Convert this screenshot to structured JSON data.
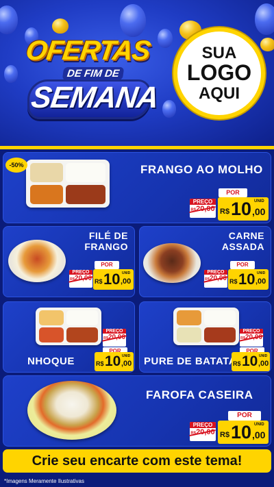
{
  "header": {
    "title_top": "OFERTAS",
    "title_mid": "DE FIM DE",
    "title_bottom": "SEMANA",
    "logo_lines": [
      "SUA",
      "LOGO",
      "AQUI"
    ]
  },
  "discount_badge": "-50%",
  "products": [
    {
      "name": "FRANGO AO MOLHO",
      "preco_label": "PREÇO",
      "old_currency": "R$",
      "old_price": "20,00",
      "por_label": "POR",
      "new_currency": "R$",
      "new_int": "10",
      "new_dec": ",00",
      "unit": "UNID"
    },
    {
      "name_lines": [
        "FILÉ DE",
        "FRANGO"
      ],
      "preco_label": "PREÇO",
      "old_currency": "R$",
      "old_price": "20,00",
      "por_label": "POR",
      "new_currency": "R$",
      "new_int": "10",
      "new_dec": ",00",
      "unit": "UNID"
    },
    {
      "name_lines": [
        "CARNE",
        "ASSADA"
      ],
      "preco_label": "PREÇO",
      "old_currency": "R$",
      "old_price": "20,00",
      "por_label": "POR",
      "new_currency": "R$",
      "new_int": "10",
      "new_dec": ",00",
      "unit": "UNID"
    },
    {
      "name": "NHOQUE",
      "preco_label": "PREÇO",
      "old_currency": "R$",
      "old_price": "20,00",
      "por_label": "POR",
      "new_currency": "R$",
      "new_int": "10",
      "new_dec": ",00",
      "unit": "UNID"
    },
    {
      "name": "PURE DE BATATA",
      "preco_label": "PREÇO",
      "old_currency": "R$",
      "old_price": "20,00",
      "por_label": "POR",
      "new_currency": "R$",
      "new_int": "10",
      "new_dec": ",00",
      "unit": "UNID"
    },
    {
      "name": "FAROFA CASEIRA",
      "preco_label": "PREÇO",
      "old_currency": "R$",
      "old_price": "20,00",
      "por_label": "POR",
      "new_currency": "R$",
      "new_int": "10",
      "new_dec": ",00",
      "unit": "UNID"
    }
  ],
  "cta": "Crie seu encarte com este tema!",
  "footnote": "*Imagens Meramente Ilustrativas",
  "colors": {
    "background": "#0b1c7a",
    "card": "#1e40c9",
    "accent_yellow": "#ffd400",
    "price_red": "#d8131f"
  }
}
